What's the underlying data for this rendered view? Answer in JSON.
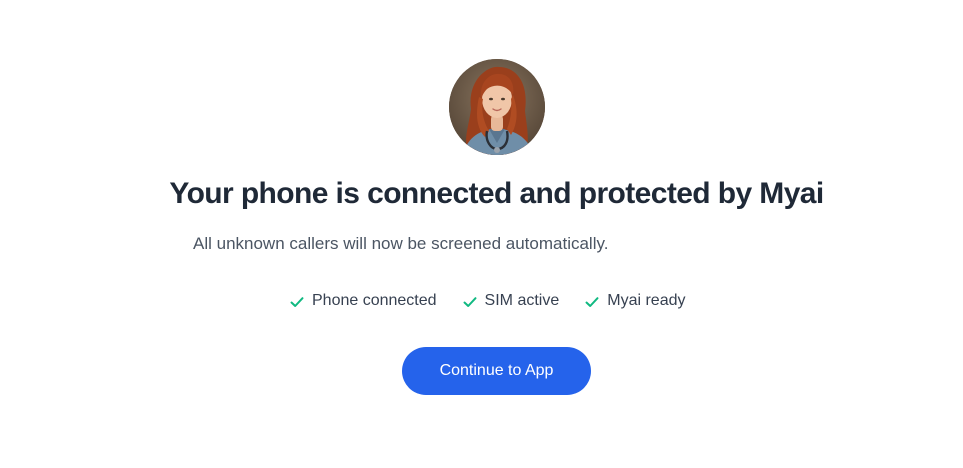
{
  "header": {
    "title": "Your phone is connected and protected by Myai",
    "subtitle": "All unknown callers will now be screened automatically."
  },
  "avatar": {
    "icon": "assistant-avatar"
  },
  "status_checks": [
    {
      "label": "Phone connected",
      "icon": "check-icon"
    },
    {
      "label": "SIM active",
      "icon": "check-icon"
    },
    {
      "label": "Myai ready",
      "icon": "check-icon"
    }
  ],
  "actions": {
    "continue_label": "Continue to App"
  },
  "colors": {
    "primary": "#2563eb",
    "check": "#10b981",
    "title": "#1f2937",
    "subtitle": "#4b5563"
  }
}
